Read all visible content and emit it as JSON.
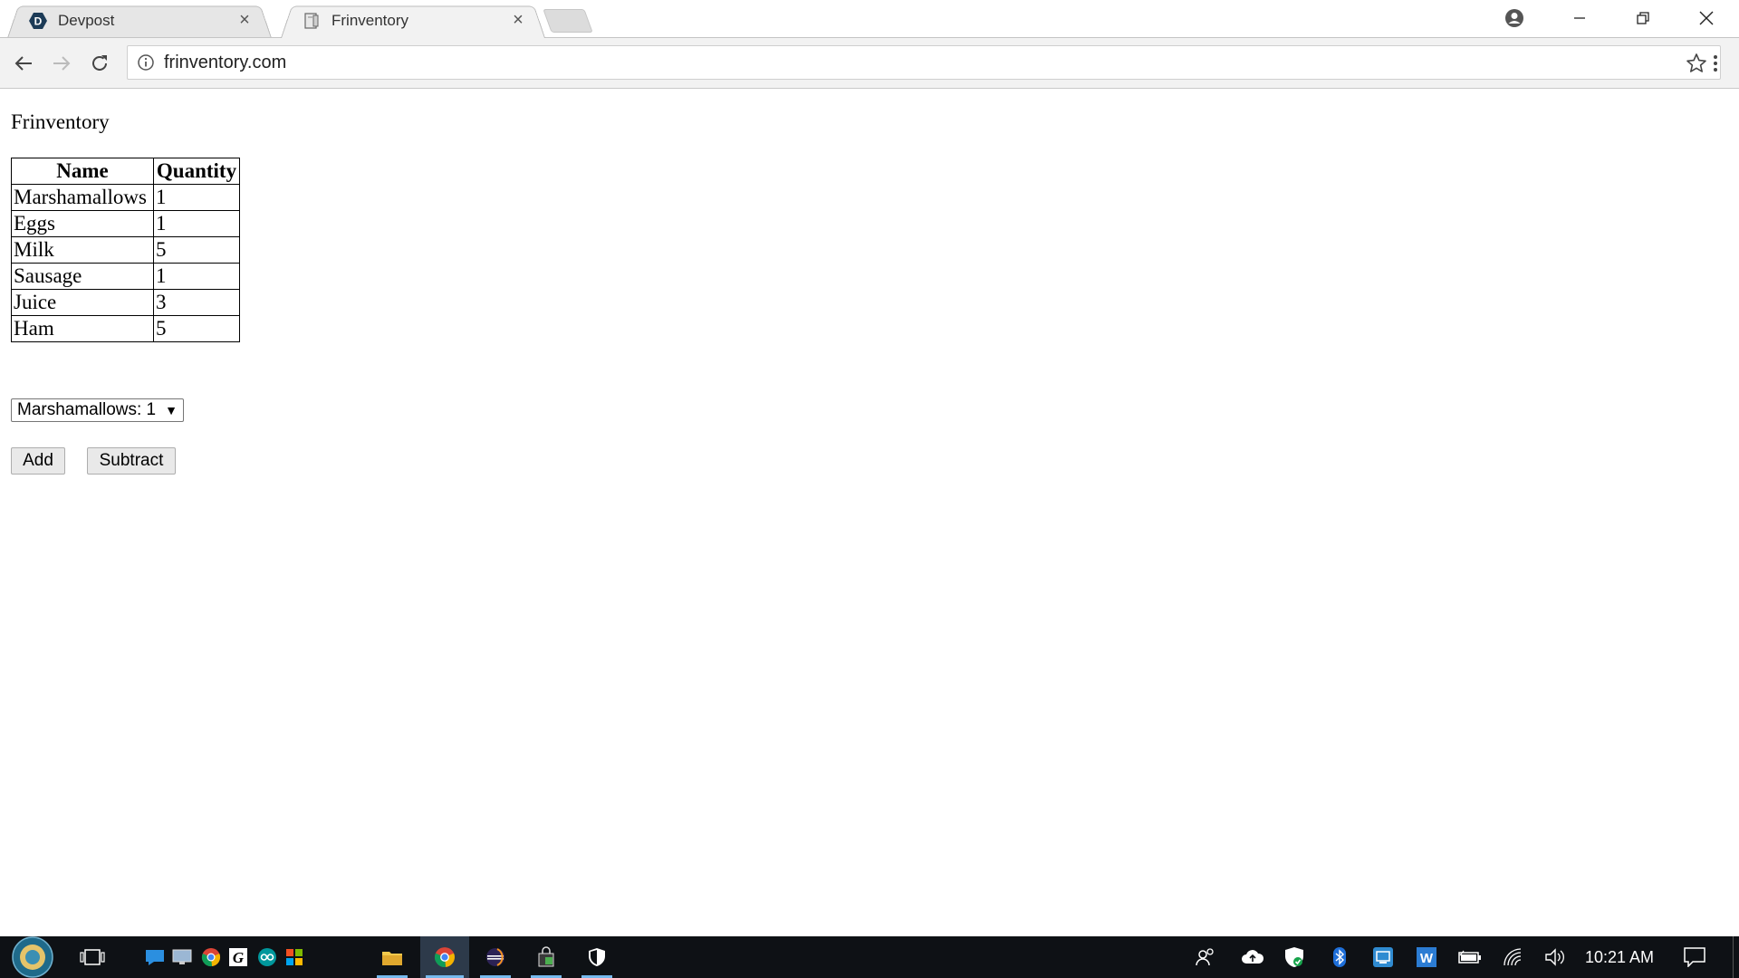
{
  "browser": {
    "tabs": [
      {
        "title": "Devpost",
        "favicon": "devpost-icon",
        "active": false
      },
      {
        "title": "Frinventory",
        "favicon": "page-file-icon",
        "active": true
      }
    ],
    "address": "frinventory.com"
  },
  "page": {
    "heading": "Frinventory",
    "table": {
      "headers": [
        "Name",
        "Quantity"
      ],
      "rows": [
        [
          "Marshamallows",
          "1"
        ],
        [
          "Eggs",
          "1"
        ],
        [
          "Milk",
          "5"
        ],
        [
          "Sausage",
          "1"
        ],
        [
          "Juice",
          "3"
        ],
        [
          "Ham",
          "5"
        ]
      ]
    },
    "select": {
      "selected": "Marshamallows: 1"
    },
    "buttons": {
      "add": "Add",
      "subtract": "Subtract"
    }
  },
  "taskbar": {
    "time": "10:21 AM"
  }
}
